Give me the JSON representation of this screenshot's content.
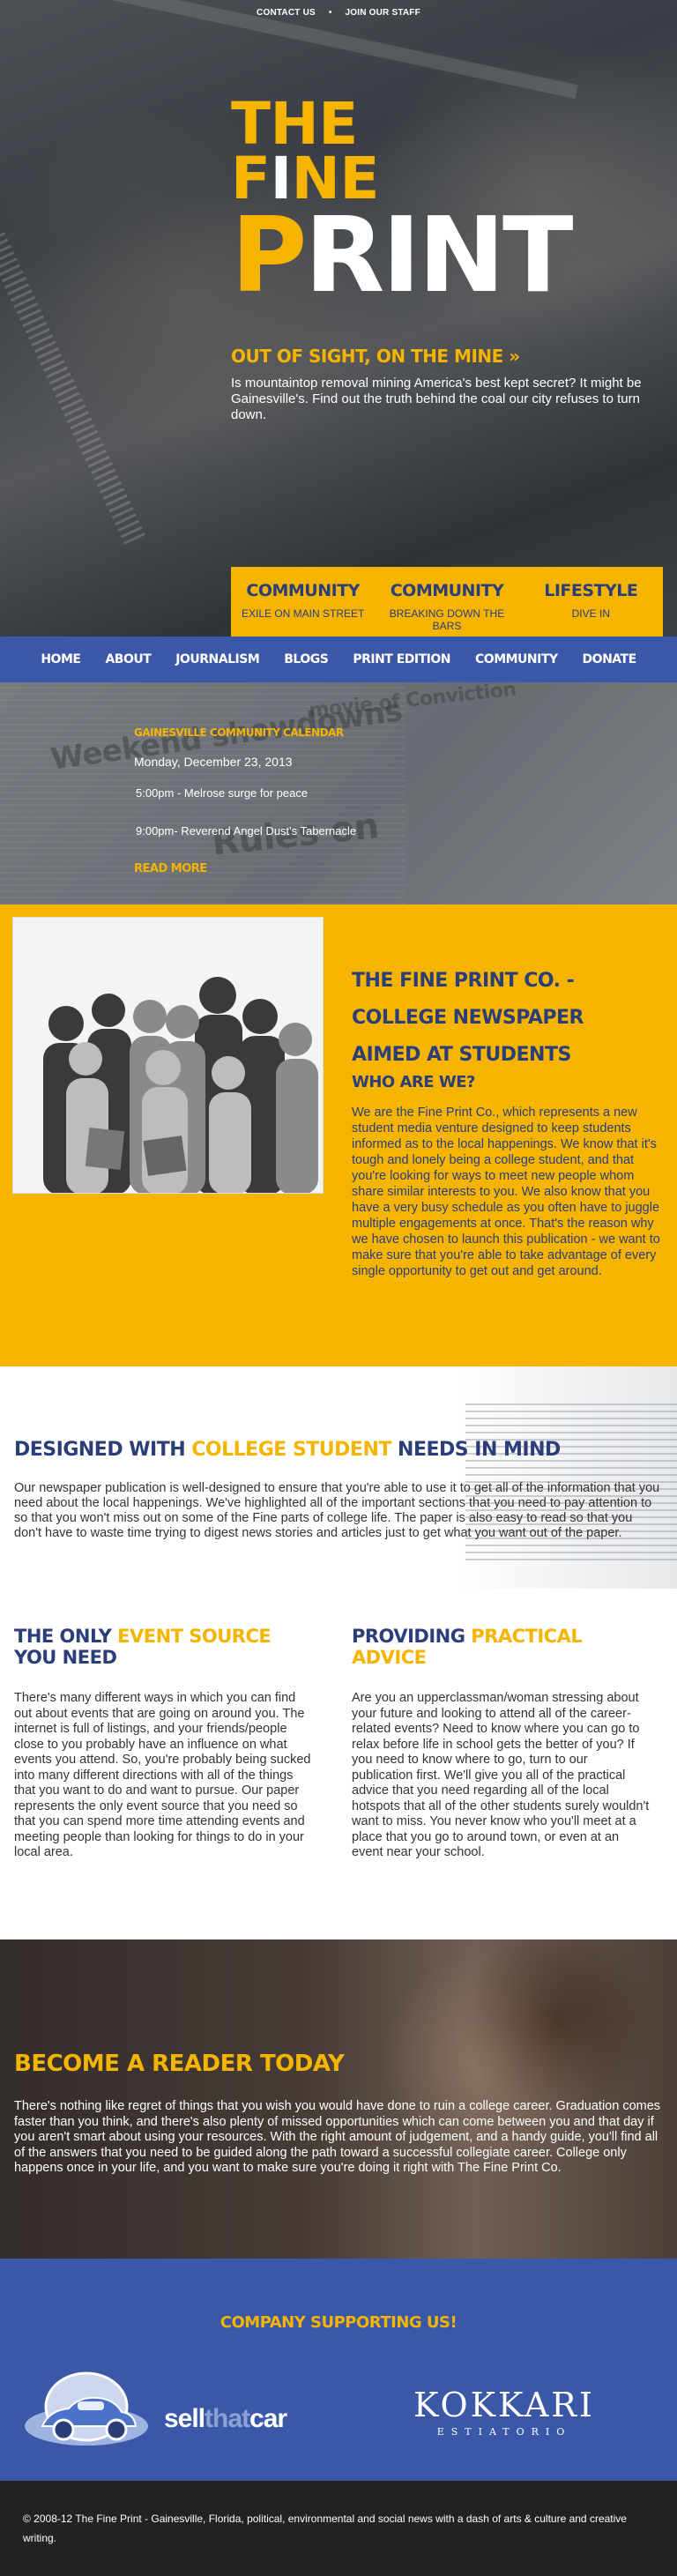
{
  "top_nav": {
    "contact": "CONTACT US",
    "staff": "JOIN OUR STAFF",
    "separator": "•"
  },
  "logo": {
    "line1_a": "THE F",
    "line1_b": "I",
    "line1_c": "NE",
    "line2_a": "P",
    "line2_b": "RINT"
  },
  "feature": {
    "title": "OUT OF SIGHT, ON THE MINE »",
    "description": "Is mountaintop removal mining America's best kept secret? It might be Gainesville's. Find out the truth behind the coal our city refuses to turn down."
  },
  "categories": [
    {
      "title": "COMMUNITY",
      "sub": "EXILE ON MAIN STREET"
    },
    {
      "title": "COMMUNITY",
      "sub": "BREAKING DOWN THE BARS"
    },
    {
      "title": "LIFESTYLE",
      "sub": "DIVE IN"
    }
  ],
  "main_nav": [
    "HOME",
    "ABOUT",
    "JOURNALISM",
    "BLOGS",
    "PRINT EDITION",
    "COMMUNITY",
    "DONATE"
  ],
  "calendar": {
    "title": "GAINESVILLE COMMUNITY CALENDAR",
    "date": "Monday, December 23, 2013",
    "events": [
      "5:00pm - Melrose surge for peace",
      "9:00pm- Reverend Angel Dust's Tabernacle"
    ],
    "more": "READ MORE",
    "background_text": [
      "Weekend showdowns",
      "Rules on",
      "movie of Conviction"
    ]
  },
  "about": {
    "title": "THE FINE PRINT CO. - COLLEGE NEWSPAPER AIMED AT STUDENTS",
    "subtitle": "WHO ARE WE?",
    "text": "We are the Fine Print Co., which represents a new student media venture designed to keep students informed as to the local happenings. We know that it's tough and lonely being a college student, and that you're looking for ways to meet new people whom share similar interests to you. We also know that you have a very busy schedule as you often have to juggle multiple engagements at once. That's the reason why we have chosen to launch this publication - we want to make sure that you're able to take advantage of every single opportunity to get out and get around."
  },
  "designed": {
    "title_a": "DESIGNED WITH ",
    "title_b": "COLLEGE STUDENT",
    "title_c": " NEEDS IN MIND",
    "text": "Our newspaper publication is well-designed to ensure that you're able to use it to get all of the information that you need about the local happenings. We've highlighted all of the important sections that you need to pay attention to so that you won't miss out on some of the Fine parts of college life. The paper is also easy to read so that you don't have to waste time trying to digest news stories and articles just to get what you want out of the paper."
  },
  "col_left": {
    "title_a": "THE ONLY ",
    "title_b": "EVENT SOURCE",
    "title_c": " YOU NEED",
    "text": "There's many different ways in which you can find out about events that are going on around you. The internet is full of listings, and your friends/people close to you probably have an influence on what events you attend. So, you're probably being sucked into many different directions with all of the things that you want to do and want to pursue. Our paper represents the only event source that you need so that you can spend more time attending events and meeting people than looking for things to do in your local area."
  },
  "col_right": {
    "title_a": "PROVIDING ",
    "title_b": "PRACTICAL ADVICE",
    "text": "Are you an upperclassman/woman stressing about your future and looking to attend all of the career-related events? Need to know where you can go to relax before life in school gets the better of you? If you need to know where to go, turn to our publication first. We'll give you all of the practical advice that you need regarding all of the local hotspots that all of the other students surely wouldn't want to miss. You never know who you'll meet at a place that you go to around town, or even at an event near your school."
  },
  "reader": {
    "title": "BECOME A READER TODAY",
    "text": "There's nothing like regret of things that you wish you would have done to ruin a college career. Graduation comes faster than you think, and there's also plenty of missed opportunities which can come between you and that day if you aren't smart about using your resources. With the right amount of judgement, and a handy guide, you'll find all of the answers that you need to be guided along the path toward a successful collegiate career. College only happens once in your life, and you want to make sure you're doing it right with The Fine Print Co."
  },
  "sponsors": {
    "title": "COMPANY SUPPORTING US!",
    "sponsor1_a": "sell",
    "sponsor1_b": "that",
    "sponsor1_c": "car",
    "sponsor2_name": "KOKKARI",
    "sponsor2_sub": "ESTIATORIO"
  },
  "footer": {
    "text": "© 2008-12 The Fine Print - Gainesville, Florida, political, environmental and social news with a dash of arts & culture and creative writing."
  },
  "colors": {
    "accent": "#f5b400",
    "nav": "#3b58a8",
    "ink": "#2c3e7a",
    "footer": "#222222"
  }
}
